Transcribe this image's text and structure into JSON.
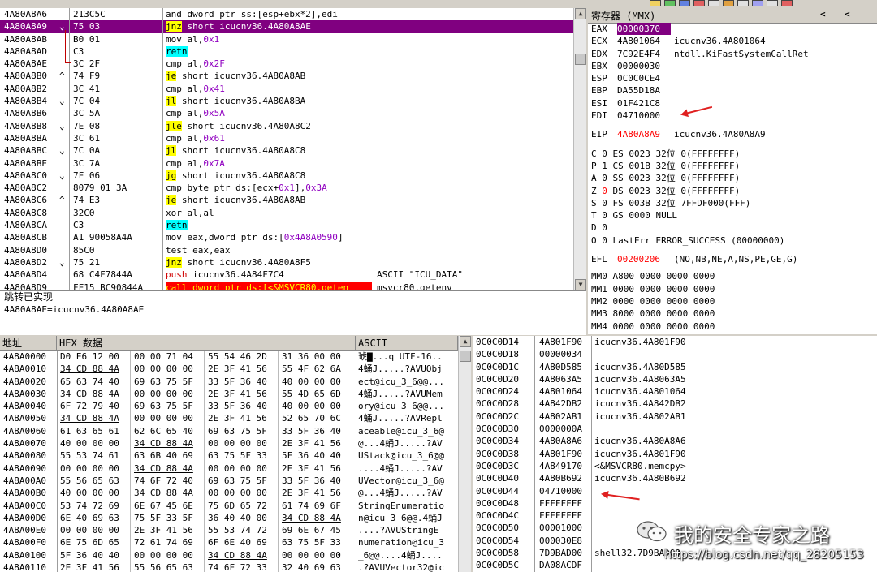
{
  "registers": {
    "title": "寄存器 (MMX)",
    "nav_prev": "<",
    "nav_next": "<",
    "close": "✕",
    "lines": [
      {
        "name": "EAX",
        "val": "00000370",
        "comment": "",
        "hl": true
      },
      {
        "name": "ECX",
        "val": "4A801064",
        "comment": "icucnv36.4A801064"
      },
      {
        "name": "EDX",
        "val": "7C92E4F4",
        "comment": "ntdll.KiFastSystemCallRet"
      },
      {
        "name": "EBX",
        "val": "00000030",
        "comment": ""
      },
      {
        "name": "ESP",
        "val": "0C0C0CE4",
        "comment": ""
      },
      {
        "name": "EBP",
        "val": "DA55D18A",
        "comment": ""
      },
      {
        "name": "ESI",
        "val": "01F421C8",
        "comment": ""
      },
      {
        "name": "EDI",
        "val": "04710000",
        "comment": ""
      }
    ],
    "eip": {
      "name": "EIP",
      "val": "4A80A8A9",
      "comment": "icucnv36.4A80A8A9"
    },
    "flags": [
      "C 0   ES 0023 32位 0(FFFFFFFF)",
      "P 1   CS 001B 32位 0(FFFFFFFF)",
      "A 0   SS 0023 32位 0(FFFFFFFF)",
      "Z 0   DS 0023 32位 0(FFFFFFFF)",
      "S 0   FS 003B 32位 7FFDF000(FFF)",
      "T 0   GS 0000 NULL",
      "D 0",
      "O 0   LastErr ERROR_SUCCESS (00000000)"
    ],
    "efl": {
      "name": "EFL",
      "val": "00200206",
      "comment": "(NO,NB,NE,A,NS,PE,GE,G)"
    },
    "mmx": [
      "MM0 A800 0000 0000 0000",
      "MM1 0000 0000 0000 0000",
      "MM2 0000 0000 0000 0000",
      "MM3 8000 0000 0000 0000",
      "MM4 0000 0000 0000 0000"
    ]
  },
  "disasm": {
    "rows": [
      {
        "addr": "4A80A8A6",
        "mark": "",
        "hex": "213C5C",
        "ins": [
          [
            "and dword ptr ss:[esp+ebx*2],edi",
            ""
          ]
        ],
        "com": ""
      },
      {
        "addr": "4A80A8A9",
        "mark": "⌄",
        "hex": "75 03",
        "ins": [
          [
            "jnz",
            "y"
          ],
          [
            " short icucnv36.4A80A8AE",
            ""
          ]
        ],
        "com": "",
        "sel": true
      },
      {
        "addr": "4A80A8AB",
        "mark": "",
        "hex": "B0 01",
        "ins": [
          [
            "mov al,",
            ""
          ],
          [
            "0x1",
            "purple"
          ]
        ],
        "com": ""
      },
      {
        "addr": "4A80A8AD",
        "mark": "",
        "hex": "C3",
        "ins": [
          [
            "retn",
            "cy"
          ]
        ],
        "com": ""
      },
      {
        "addr": "4A80A8AE",
        "mark": "",
        "hex": "3C 2F",
        "ins": [
          [
            "cmp al,",
            ""
          ],
          [
            "0x2F",
            "purple"
          ]
        ],
        "com": ""
      },
      {
        "addr": "4A80A8B0",
        "mark": "^",
        "hex": "74 F9",
        "ins": [
          [
            "je",
            "y"
          ],
          [
            " short icucnv36.4A80A8AB",
            ""
          ]
        ],
        "com": ""
      },
      {
        "addr": "4A80A8B2",
        "mark": "",
        "hex": "3C 41",
        "ins": [
          [
            "cmp al,",
            ""
          ],
          [
            "0x41",
            "purple"
          ]
        ],
        "com": ""
      },
      {
        "addr": "4A80A8B4",
        "mark": "⌄",
        "hex": "7C 04",
        "ins": [
          [
            "jl",
            "y"
          ],
          [
            " short icucnv36.4A80A8BA",
            ""
          ]
        ],
        "com": ""
      },
      {
        "addr": "4A80A8B6",
        "mark": "",
        "hex": "3C 5A",
        "ins": [
          [
            "cmp al,",
            ""
          ],
          [
            "0x5A",
            "purple"
          ]
        ],
        "com": ""
      },
      {
        "addr": "4A80A8B8",
        "mark": "⌄",
        "hex": "7E 08",
        "ins": [
          [
            "jle",
            "y"
          ],
          [
            " short icucnv36.4A80A8C2",
            ""
          ]
        ],
        "com": ""
      },
      {
        "addr": "4A80A8BA",
        "mark": "",
        "hex": "3C 61",
        "ins": [
          [
            "cmp al,",
            ""
          ],
          [
            "0x61",
            "purple"
          ]
        ],
        "com": ""
      },
      {
        "addr": "4A80A8BC",
        "mark": "⌄",
        "hex": "7C 0A",
        "ins": [
          [
            "jl",
            "y"
          ],
          [
            " short icucnv36.4A80A8C8",
            ""
          ]
        ],
        "com": ""
      },
      {
        "addr": "4A80A8BE",
        "mark": "",
        "hex": "3C 7A",
        "ins": [
          [
            "cmp al,",
            ""
          ],
          [
            "0x7A",
            "purple"
          ]
        ],
        "com": ""
      },
      {
        "addr": "4A80A8C0",
        "mark": "⌄",
        "hex": "7F 06",
        "ins": [
          [
            "jg",
            "y"
          ],
          [
            " short icucnv36.4A80A8C8",
            ""
          ]
        ],
        "com": ""
      },
      {
        "addr": "4A80A8C2",
        "mark": "",
        "hex": "8079 01 3A",
        "ins": [
          [
            "cmp byte ptr ds:[ecx+",
            ""
          ],
          [
            "0x1",
            "purple"
          ],
          [
            "],",
            ""
          ],
          [
            "0x3A",
            "purple"
          ]
        ],
        "com": ""
      },
      {
        "addr": "4A80A8C6",
        "mark": "^",
        "hex": "74 E3",
        "ins": [
          [
            "je",
            "y"
          ],
          [
            " short icucnv36.4A80A8AB",
            ""
          ]
        ],
        "com": ""
      },
      {
        "addr": "4A80A8C8",
        "mark": "",
        "hex": "32C0",
        "ins": [
          [
            "xor al,al",
            ""
          ]
        ],
        "com": ""
      },
      {
        "addr": "4A80A8CA",
        "mark": "",
        "hex": "C3",
        "ins": [
          [
            "retn",
            "cy"
          ]
        ],
        "com": ""
      },
      {
        "addr": "4A80A8CB",
        "mark": "",
        "hex": "A1 90058A4A",
        "ins": [
          [
            "mov eax,dword ptr ds:[",
            ""
          ],
          [
            "0x4A8A0590",
            "purple"
          ],
          [
            "]",
            ""
          ]
        ],
        "com": ""
      },
      {
        "addr": "4A80A8D0",
        "mark": "",
        "hex": "85C0",
        "ins": [
          [
            "test eax,eax",
            ""
          ]
        ],
        "com": ""
      },
      {
        "addr": "4A80A8D2",
        "mark": "⌄",
        "hex": "75 21",
        "ins": [
          [
            "jnz",
            "y"
          ],
          [
            " short icucnv36.4A80A8F5",
            ""
          ]
        ],
        "com": ""
      },
      {
        "addr": "4A80A8D4",
        "mark": "",
        "hex": "68 C4F7844A",
        "ins": [
          [
            "push",
            "red"
          ],
          [
            " icucnv36.4A84F7C4",
            ""
          ]
        ],
        "com": "ASCII \"ICU_DATA\""
      },
      {
        "addr": "4A80A8D9",
        "mark": "",
        "hex": "FF15 BC90844A",
        "ins": [
          [
            "call",
            "call"
          ],
          [
            " dword ptr ds:[<&MSVCR80.geten",
            ""
          ]
        ],
        "com": "msvcr80.getenv"
      }
    ],
    "info_line1": "跳转已实现",
    "info_line2": "4A80A8AE=icucnv36.4A80A8AE"
  },
  "dump": {
    "headers": {
      "addr": "地址",
      "hex": "HEX 数据",
      "ascii": "ASCII"
    },
    "rows": [
      [
        "4A8A0000",
        "D0 E6 12 00",
        "00 00 71 04",
        "55 54 46 2D",
        "31 36 00 00",
        "琥▇...q UTF-16.."
      ],
      [
        "4A8A0010",
        "34 CD 88 4A",
        "00 00 00 00",
        "2E 3F 41 56",
        "55 4F 62 6A",
        "4蛹J.....?AVUObj"
      ],
      [
        "4A8A0020",
        "65 63 74 40",
        "69 63 75 5F",
        "33 5F 36 40",
        "40 00 00 00",
        "ect@icu_3_6@@..."
      ],
      [
        "4A8A0030",
        "34 CD 88 4A",
        "00 00 00 00",
        "2E 3F 41 56",
        "55 4D 65 6D",
        "4蛹J.....?AVUMem"
      ],
      [
        "4A8A0040",
        "6F 72 79 40",
        "69 63 75 5F",
        "33 5F 36 40",
        "40 00 00 00",
        "ory@icu_3_6@@..."
      ],
      [
        "4A8A0050",
        "34 CD 88 4A",
        "00 00 00 00",
        "2E 3F 41 56",
        "52 65 70 6C",
        "4蛹J.....?AVRepl"
      ],
      [
        "4A8A0060",
        "61 63 65 61",
        "62 6C 65 40",
        "69 63 75 5F",
        "33 5F 36 40",
        "aceable@icu_3_6@"
      ],
      [
        "4A8A0070",
        "40 00 00 00",
        "34 CD 88 4A",
        "00 00 00 00",
        "2E 3F 41 56",
        "@...4蛹J.....?AV"
      ],
      [
        "4A8A0080",
        "55 53 74 61",
        "63 6B 40 69",
        "63 75 5F 33",
        "5F 36 40 40",
        "UStack@icu_3_6@@"
      ],
      [
        "4A8A0090",
        "00 00 00 00",
        "34 CD 88 4A",
        "00 00 00 00",
        "2E 3F 41 56",
        "....4蛹J.....?AV"
      ],
      [
        "4A8A00A0",
        "55 56 65 63",
        "74 6F 72 40",
        "69 63 75 5F",
        "33 5F 36 40",
        "UVector@icu_3_6@"
      ],
      [
        "4A8A00B0",
        "40 00 00 00",
        "34 CD 88 4A",
        "00 00 00 00",
        "2E 3F 41 56",
        "@...4蛹J.....?AV"
      ],
      [
        "4A8A00C0",
        "53 74 72 69",
        "6E 67 45 6E",
        "75 6D 65 72",
        "61 74 69 6F",
        "StringEnumeratio"
      ],
      [
        "4A8A00D0",
        "6E 40 69 63",
        "75 5F 33 5F",
        "36 40 40 00",
        "34 CD 88 4A",
        "n@icu_3_6@@.4蛹J"
      ],
      [
        "4A8A00E0",
        "00 00 00 00",
        "2E 3F 41 56",
        "55 53 74 72",
        "69 6E 67 45",
        "....?AVUStringE"
      ],
      [
        "4A8A00F0",
        "6E 75 6D 65",
        "72 61 74 69",
        "6F 6E 40 69",
        "63 75 5F 33",
        "numeration@icu_3"
      ],
      [
        "4A8A0100",
        "5F 36 40 40",
        "00 00 00 00",
        "34 CD 88 4A",
        "00 00 00 00",
        "_6@@....4蛹J...."
      ],
      [
        "4A8A0110",
        "2E 3F 41 56",
        "55 56 65 63",
        "74 6F 72 33",
        "32 40 69 63",
        ".?AVUVector32@ic"
      ]
    ]
  },
  "stack": {
    "rows": [
      [
        "0C0C0D14",
        "4A801F90",
        "icucnv36.4A801F90"
      ],
      [
        "0C0C0D18",
        "00000034",
        ""
      ],
      [
        "0C0C0D1C",
        "4A80D585",
        "icucnv36.4A80D585"
      ],
      [
        "0C0C0D20",
        "4A8063A5",
        "icucnv36.4A8063A5"
      ],
      [
        "0C0C0D24",
        "4A801064",
        "icucnv36.4A801064"
      ],
      [
        "0C0C0D28",
        "4A842DB2",
        "icucnv36.4A842DB2"
      ],
      [
        "0C0C0D2C",
        "4A802AB1",
        "icucnv36.4A802AB1"
      ],
      [
        "0C0C0D30",
        "0000000A",
        ""
      ],
      [
        "0C0C0D34",
        "4A80A8A6",
        "icucnv36.4A80A8A6"
      ],
      [
        "0C0C0D38",
        "4A801F90",
        "icucnv36.4A801F90"
      ],
      [
        "0C0C0D3C",
        "4A849170",
        "<&MSVCR80.memcpy>"
      ],
      [
        "0C0C0D40",
        "4A80B692",
        "icucnv36.4A80B692"
      ],
      [
        "0C0C0D44",
        "04710000",
        ""
      ],
      [
        "0C0C0D48",
        "FFFFFFFF",
        ""
      ],
      [
        "0C0C0D4C",
        "FFFFFFFF",
        ""
      ],
      [
        "0C0C0D50",
        "00001000",
        ""
      ],
      [
        "0C0C0D54",
        "000030E8",
        ""
      ],
      [
        "0C0C0D58",
        "7D9BAD00",
        "shell32.7D9BAD00"
      ],
      [
        "0C0C0D5C",
        "DA08ACDF",
        ""
      ]
    ]
  },
  "watermark": {
    "brand": "我的安全专家之路",
    "url": "https://blog.csdn.net/qq_28205153"
  }
}
